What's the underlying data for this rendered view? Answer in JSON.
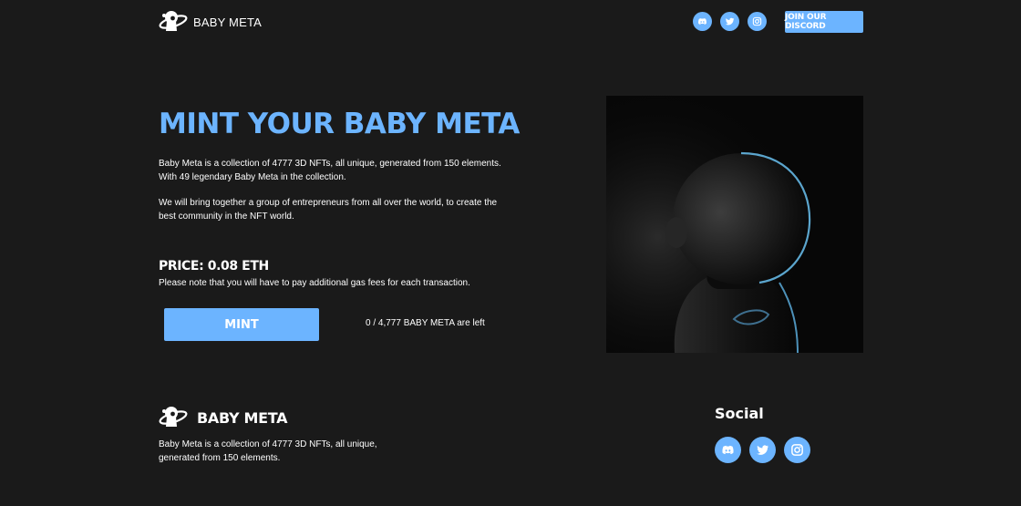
{
  "header": {
    "brand_name": "BABY META",
    "social_icons": [
      "discord-icon",
      "twitter-icon",
      "instagram-icon"
    ],
    "discord_button_label": "JOIN OUR DISCORD"
  },
  "hero": {
    "title": "MINT YOUR BABY META",
    "description_1": "Baby Meta is a collection of 4777 3D NFTs, all unique, generated from 150 elements. With 49 legendary Baby Meta in the collection.",
    "description_2": "We will bring together a group of entrepreneurs from all over the world, to create the best community in the NFT world.",
    "price": "PRICE: 0.08 ETH",
    "gas_note": "Please note that you will have to pay additional gas fees for each transaction.",
    "mint_button_label": "MINT",
    "supply_text": "0 / 4,777 BABY META are left",
    "image": "baby-meta-character-image"
  },
  "footer": {
    "brand_name": "BABY META",
    "description": "Baby Meta is a collection of 4777 3D NFTs, all unique, generated from 150 elements.",
    "social_title": "Social",
    "social_icons": [
      "discord-icon",
      "twitter-icon",
      "instagram-icon"
    ]
  },
  "colors": {
    "background": "#1a1a1a",
    "accent": "#6cb4ff",
    "text": "#ffffff"
  }
}
